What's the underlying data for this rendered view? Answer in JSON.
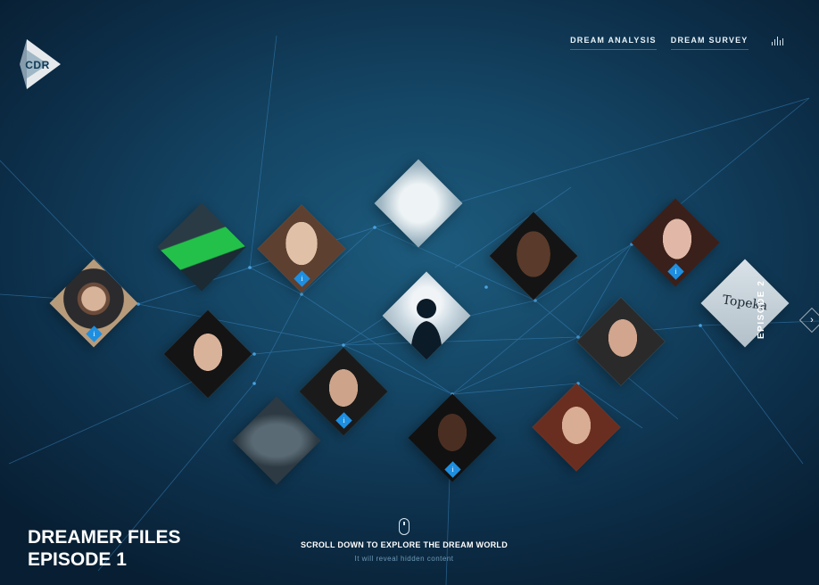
{
  "brand": {
    "logo_text": "CDR"
  },
  "nav": {
    "links": [
      "DREAM ANALYSIS",
      "DREAM SURVEY"
    ],
    "sound_icon": "equalizer-icon"
  },
  "episode_title": {
    "line1": "DREAMER FILES",
    "line2": "EPISODE 1"
  },
  "next_episode": {
    "label": "EPISODE 2",
    "arrow_icon": "chevron-right-icon"
  },
  "scroll_hint": {
    "icon": "mouse-icon",
    "title": "SCROLL DOWN TO EXPLORE THE DREAM WORLD",
    "subtitle": "It will reveal hidden content"
  },
  "tiles": [
    {
      "name": "tile-bearded-man",
      "kind": "portrait",
      "has_info": true
    },
    {
      "name": "tile-green-sneaker",
      "kind": "object",
      "has_info": false
    },
    {
      "name": "tile-woman-long-hair",
      "kind": "portrait",
      "has_info": true
    },
    {
      "name": "tile-sketch-drawing",
      "kind": "object",
      "has_info": false
    },
    {
      "name": "tile-woman-short-hair",
      "kind": "portrait",
      "has_info": false
    },
    {
      "name": "tile-dark-haired-woman",
      "kind": "portrait",
      "has_info": true
    },
    {
      "name": "tile-child-silhouette",
      "kind": "silhouette",
      "has_info": false
    },
    {
      "name": "tile-topeka-note",
      "kind": "object",
      "text": "Topeka",
      "has_info": false
    },
    {
      "name": "tile-asian-woman",
      "kind": "portrait",
      "has_info": false
    },
    {
      "name": "tile-asian-man",
      "kind": "portrait",
      "has_info": true
    },
    {
      "name": "tile-older-man",
      "kind": "portrait",
      "has_info": false
    },
    {
      "name": "tile-cap-object",
      "kind": "object",
      "has_info": false
    },
    {
      "name": "tile-man-in-suit",
      "kind": "portrait",
      "has_info": true
    },
    {
      "name": "tile-red-haired-woman",
      "kind": "portrait",
      "has_info": false
    }
  ],
  "colors": {
    "background": "#144564",
    "accent": "#1e8fe0",
    "network_line": "#3a86c0",
    "muted_text": "#6f9ab4"
  }
}
